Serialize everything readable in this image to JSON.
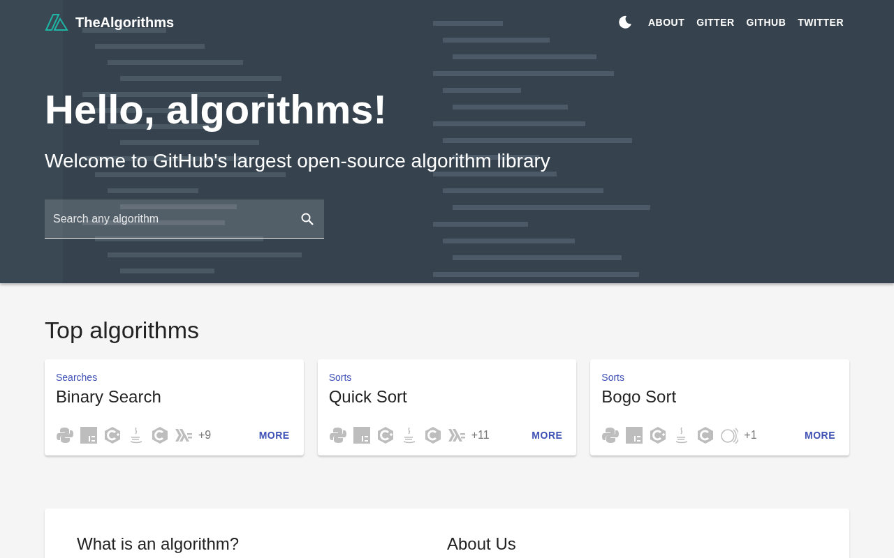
{
  "header": {
    "brand": "TheAlgorithms",
    "nav": [
      "ABOUT",
      "GITTER",
      "GITHUB",
      "TWITTER"
    ]
  },
  "hero": {
    "title": "Hello, algorithms!",
    "subtitle": "Welcome to GitHub's largest open-source algorithm library",
    "search": {
      "placeholder": "Search any algorithm"
    }
  },
  "top": {
    "title": "Top algorithms",
    "cards": [
      {
        "category": "Searches",
        "name": "Binary Search",
        "languages": [
          {
            "kind": "python"
          },
          {
            "kind": "javascript"
          },
          {
            "kind": "cpp"
          },
          {
            "kind": "java"
          },
          {
            "kind": "c"
          },
          {
            "kind": "haskell"
          }
        ],
        "extra": "+9",
        "action": "MORE"
      },
      {
        "category": "Sorts",
        "name": "Quick Sort",
        "languages": [
          {
            "kind": "python"
          },
          {
            "kind": "javascript"
          },
          {
            "kind": "cpp"
          },
          {
            "kind": "java"
          },
          {
            "kind": "c"
          },
          {
            "kind": "haskell"
          }
        ],
        "extra": "+11",
        "action": "MORE"
      },
      {
        "category": "Sorts",
        "name": "Bogo Sort",
        "languages": [
          {
            "kind": "python"
          },
          {
            "kind": "javascript"
          },
          {
            "kind": "cpp"
          },
          {
            "kind": "java"
          },
          {
            "kind": "c"
          },
          {
            "kind": "c64"
          }
        ],
        "extra": "+1",
        "action": "MORE"
      }
    ]
  },
  "info": {
    "columns": [
      "What is an algorithm?",
      "About Us"
    ]
  }
}
